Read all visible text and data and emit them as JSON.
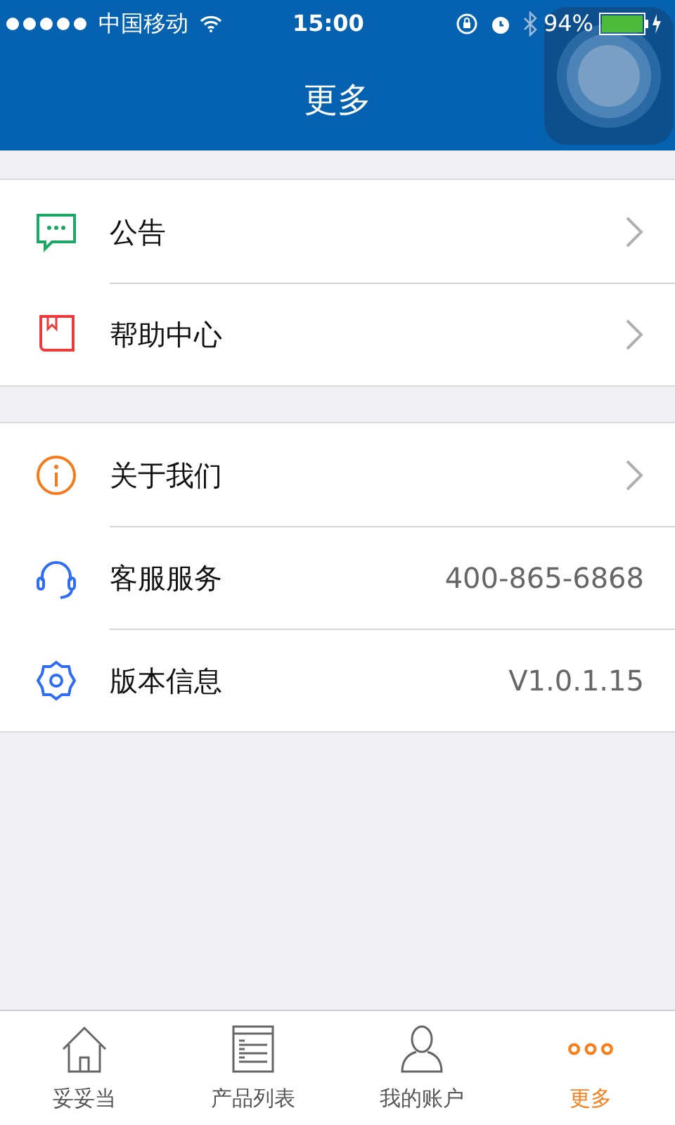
{
  "status_bar": {
    "carrier": "中国移动",
    "time": "15:00",
    "battery": "94%"
  },
  "nav_bar": {
    "title": "更多"
  },
  "sections": [
    {
      "rows": [
        {
          "label": "公告",
          "kind": "link"
        },
        {
          "label": "帮助中心",
          "kind": "link"
        }
      ]
    },
    {
      "rows": [
        {
          "label": "关于我们",
          "kind": "link"
        },
        {
          "label": "客服服务",
          "kind": "value",
          "value": "400-865-6868"
        },
        {
          "label": "版本信息",
          "kind": "value",
          "value": "V1.0.1.15"
        }
      ]
    }
  ],
  "tab_bar": [
    {
      "label": "妥妥当",
      "selected": false
    },
    {
      "label": "产品列表",
      "selected": false
    },
    {
      "label": "我的账户",
      "selected": false
    },
    {
      "label": "更多",
      "selected": true
    }
  ]
}
